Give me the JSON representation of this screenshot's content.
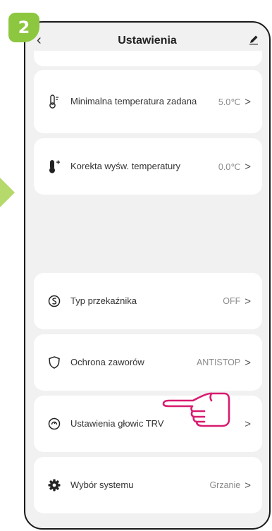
{
  "step": {
    "number": "2"
  },
  "header": {
    "title": "Ustawienia",
    "back_icon": "chevron-left-icon",
    "edit_icon": "pencil-icon"
  },
  "settings": [
    {
      "icon": "min-thermometer-icon",
      "label": "Minimalna temperatura zadana",
      "value": "5.0℃"
    },
    {
      "icon": "thermometer-correction-icon",
      "label": "Korekta wyśw. temperatury",
      "value": "0.0℃"
    },
    {
      "icon": "relay-icon",
      "label": "Typ przekaźnika",
      "value": "OFF"
    },
    {
      "icon": "shield-icon",
      "label": "Ochrona zaworów",
      "value": "ANTISTOP"
    },
    {
      "icon": "trv-head-icon",
      "label": "Ustawienia głowic TRV",
      "value": ""
    },
    {
      "icon": "gear-icon",
      "label": "Wybór systemu",
      "value": "Grzanie"
    }
  ],
  "chevron_glyph": ">",
  "colors": {
    "badge": "#8dc63f",
    "arrow": "#b5d96b",
    "pointer_hand": "#d81b6f",
    "background": "#f1f1f1"
  }
}
